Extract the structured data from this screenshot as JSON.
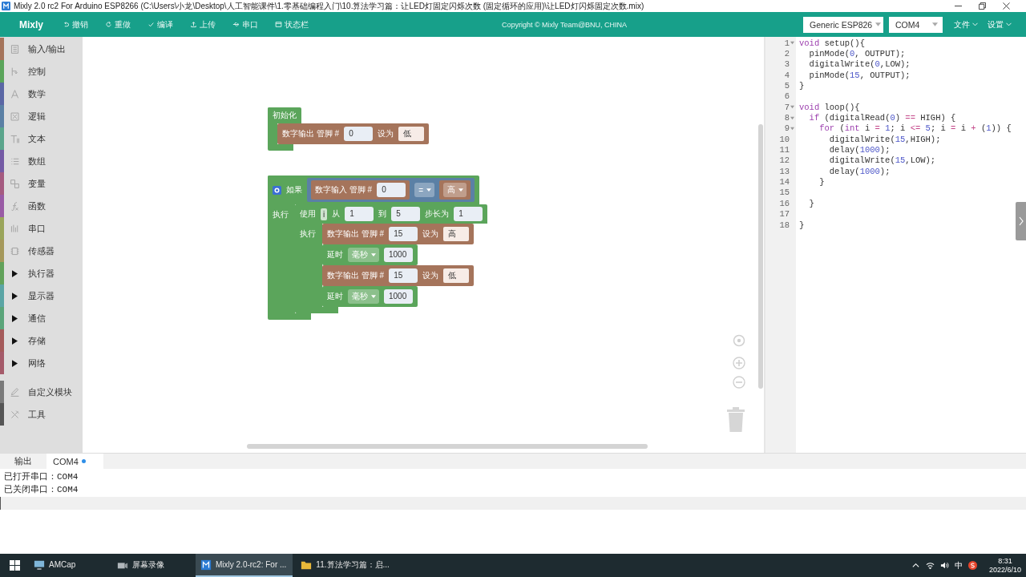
{
  "window": {
    "title": "Mixly 2.0 rc2 For Arduino ESP8266 (C:\\Users\\小龙\\Desktop\\人工智能课件\\1.零基础编程入门\\10.算法学习篇：让LED灯固定闪烁次数 (固定循环的应用)\\让LED灯闪烁固定次数.mix)"
  },
  "toolbar": {
    "brand": "Mixly",
    "buttons": [
      {
        "label": "撤销"
      },
      {
        "label": "重做"
      },
      {
        "label": "编译"
      },
      {
        "label": "上传"
      },
      {
        "label": "串口"
      },
      {
        "label": "状态栏"
      }
    ],
    "copyright": "Copyright © Mixly Team@BNU, CHINA",
    "board": "Generic ESP826",
    "port": "COM4",
    "menus": [
      {
        "label": "文件"
      },
      {
        "label": "设置"
      }
    ]
  },
  "sidebar": {
    "groups": [
      {
        "items": [
          {
            "label": "输入/输出",
            "kind": "category",
            "color": "#a5745b",
            "selected": false
          },
          {
            "label": "控制",
            "kind": "category",
            "color": "#5ba55b",
            "selected": false
          },
          {
            "label": "数学",
            "kind": "category",
            "color": "#5b67a5",
            "selected": false
          },
          {
            "label": "逻辑",
            "kind": "category",
            "color": "#5b80a5",
            "selected": false
          },
          {
            "label": "文本",
            "kind": "category",
            "color": "#5ba58c",
            "selected": false
          },
          {
            "label": "数组",
            "kind": "category",
            "color": "#745ba5",
            "selected": false
          },
          {
            "label": "变量",
            "kind": "category",
            "color": "#a55b80",
            "selected": false
          },
          {
            "label": "函数",
            "kind": "category",
            "color": "#995ba5",
            "selected": false
          },
          {
            "label": "串口",
            "kind": "category",
            "color": "#9aa55b",
            "selected": false
          },
          {
            "label": "传感器",
            "kind": "category",
            "color": "#a5985b",
            "selected": false
          },
          {
            "label": "执行器",
            "kind": "folder",
            "color": "#62a25b",
            "selected": false
          },
          {
            "label": "显示器",
            "kind": "folder",
            "color": "#5ba5a5",
            "selected": false
          },
          {
            "label": "通信",
            "kind": "folder",
            "color": "#5ba57a",
            "selected": false
          },
          {
            "label": "存储",
            "kind": "folder",
            "color": "#a55b5b",
            "selected": false
          },
          {
            "label": "网络",
            "kind": "folder",
            "color": "#a55b6a",
            "selected": false
          }
        ]
      },
      {
        "items": [
          {
            "label": "自定义模块",
            "kind": "category",
            "color": "#7a7a7a",
            "selected": false
          },
          {
            "label": "工具",
            "kind": "category",
            "color": "#555555",
            "selected": false
          }
        ]
      }
    ]
  },
  "workspace": {
    "blocks": [
      {
        "kind": "container",
        "color": "#5ba55b",
        "parts": [
          {
            "kind": "label",
            "text": "初始化"
          }
        ],
        "sections": [
          {
            "body": [
              {
                "kind": "statement",
                "color": "#a5745b",
                "parts": [
                  {
                    "kind": "label",
                    "text": "数字输出 管脚 #"
                  },
                  {
                    "kind": "number",
                    "text": "0"
                  },
                  {
                    "kind": "label",
                    "text": "设为"
                  },
                  {
                    "kind": "field",
                    "text": "低"
                  }
                ]
              }
            ]
          }
        ]
      },
      {
        "kind": "container",
        "color": "#5ba55b",
        "parts": [
          {
            "kind": "gear"
          },
          {
            "kind": "label",
            "text": "如果"
          },
          {
            "kind": "block",
            "block": {
              "kind": "value",
              "color": "#5b80a5",
              "parts": [
                {
                  "kind": "block",
                  "block": {
                    "kind": "value",
                    "color": "#a5745b",
                    "parts": [
                      {
                        "kind": "label",
                        "text": "数字输入 管脚 #"
                      },
                      {
                        "kind": "number",
                        "text": "0"
                      }
                    ]
                  }
                },
                {
                  "kind": "dropdown",
                  "text": "="
                },
                {
                  "kind": "block",
                  "block": {
                    "kind": "value",
                    "color": "#a5745b",
                    "parts": [
                      {
                        "kind": "dropdown",
                        "text": "高"
                      }
                    ]
                  }
                }
              ]
            }
          }
        ],
        "sections": [
          {
            "label": "执行",
            "body": [
              {
                "kind": "container",
                "color": "#5ba55b",
                "parts": [
                  {
                    "kind": "label",
                    "text": "使用"
                  },
                  {
                    "kind": "variable",
                    "text": "i"
                  },
                  {
                    "kind": "label",
                    "text": "从"
                  },
                  {
                    "kind": "number",
                    "text": "1"
                  },
                  {
                    "kind": "label",
                    "text": "到"
                  },
                  {
                    "kind": "number",
                    "text": "5"
                  },
                  {
                    "kind": "label",
                    "text": "步长为"
                  },
                  {
                    "kind": "number",
                    "text": "1"
                  }
                ],
                "sections": [
                  {
                    "label": "执行",
                    "body": [
                      {
                        "kind": "statement",
                        "color": "#a5745b",
                        "parts": [
                          {
                            "kind": "label",
                            "text": "数字输出 管脚 #"
                          },
                          {
                            "kind": "number",
                            "text": "15"
                          },
                          {
                            "kind": "label",
                            "text": "设为"
                          },
                          {
                            "kind": "field",
                            "text": "高"
                          }
                        ]
                      },
                      {
                        "kind": "statement",
                        "color": "#5ba55b",
                        "parts": [
                          {
                            "kind": "label",
                            "text": "延时"
                          },
                          {
                            "kind": "dropdown",
                            "text": "毫秒"
                          },
                          {
                            "kind": "number",
                            "text": "1000"
                          }
                        ]
                      },
                      {
                        "kind": "statement",
                        "color": "#a5745b",
                        "parts": [
                          {
                            "kind": "label",
                            "text": "数字输出 管脚 #"
                          },
                          {
                            "kind": "number",
                            "text": "15"
                          },
                          {
                            "kind": "label",
                            "text": "设为"
                          },
                          {
                            "kind": "field",
                            "text": "低"
                          }
                        ]
                      },
                      {
                        "kind": "statement",
                        "color": "#5ba55b",
                        "parts": [
                          {
                            "kind": "label",
                            "text": "延时"
                          },
                          {
                            "kind": "dropdown",
                            "text": "毫秒"
                          },
                          {
                            "kind": "number",
                            "text": "1000"
                          }
                        ]
                      }
                    ]
                  }
                ]
              }
            ]
          }
        ]
      }
    ]
  },
  "code": {
    "lines": [
      {
        "number": "1",
        "foldable": true,
        "tokens": [
          {
            "kind": "keyword",
            "text": "void"
          },
          {
            "kind": "plain",
            "text": " setup(){"
          }
        ]
      },
      {
        "number": "2",
        "foldable": false,
        "tokens": [
          {
            "kind": "plain",
            "text": "  pinMode("
          },
          {
            "kind": "number",
            "text": "0"
          },
          {
            "kind": "plain",
            "text": ", OUTPUT);"
          }
        ]
      },
      {
        "number": "3",
        "foldable": false,
        "tokens": [
          {
            "kind": "plain",
            "text": "  digitalWrite("
          },
          {
            "kind": "number",
            "text": "0"
          },
          {
            "kind": "plain",
            "text": ",LOW);"
          }
        ]
      },
      {
        "number": "4",
        "foldable": false,
        "tokens": [
          {
            "kind": "plain",
            "text": "  pinMode("
          },
          {
            "kind": "number",
            "text": "15"
          },
          {
            "kind": "plain",
            "text": ", OUTPUT);"
          }
        ]
      },
      {
        "number": "5",
        "foldable": false,
        "tokens": [
          {
            "kind": "plain",
            "text": "}"
          }
        ]
      },
      {
        "number": "6",
        "foldable": false
      },
      {
        "number": "7",
        "foldable": true,
        "tokens": [
          {
            "kind": "keyword",
            "text": "void"
          },
          {
            "kind": "plain",
            "text": " loop(){"
          }
        ]
      },
      {
        "number": "8",
        "foldable": true,
        "tokens": [
          {
            "kind": "keyword",
            "text": "  if"
          },
          {
            "kind": "plain",
            "text": " (digitalRead("
          },
          {
            "kind": "number",
            "text": "0"
          },
          {
            "kind": "plain",
            "text": ") "
          },
          {
            "kind": "operator",
            "text": "=="
          },
          {
            "kind": "plain",
            "text": " HIGH) {"
          }
        ]
      },
      {
        "number": "9",
        "foldable": true,
        "tokens": [
          {
            "kind": "keyword",
            "text": "    for"
          },
          {
            "kind": "plain",
            "text": " ("
          },
          {
            "kind": "keyword",
            "text": "int"
          },
          {
            "kind": "plain",
            "text": " i "
          },
          {
            "kind": "operator",
            "text": "="
          },
          {
            "kind": "number",
            "text": " 1"
          },
          {
            "kind": "plain",
            "text": "; i "
          },
          {
            "kind": "operator",
            "text": "<="
          },
          {
            "kind": "number",
            "text": " 5"
          },
          {
            "kind": "plain",
            "text": "; i "
          },
          {
            "kind": "operator",
            "text": "="
          },
          {
            "kind": "plain",
            "text": " i "
          },
          {
            "kind": "operator",
            "text": "+"
          },
          {
            "kind": "plain",
            "text": " ("
          },
          {
            "kind": "number",
            "text": "1"
          },
          {
            "kind": "plain",
            "text": ")) {"
          }
        ]
      },
      {
        "number": "10",
        "foldable": false,
        "tokens": [
          {
            "kind": "plain",
            "text": "      digitalWrite("
          },
          {
            "kind": "number",
            "text": "15"
          },
          {
            "kind": "plain",
            "text": ",HIGH);"
          }
        ]
      },
      {
        "number": "11",
        "foldable": false,
        "tokens": [
          {
            "kind": "plain",
            "text": "      delay("
          },
          {
            "kind": "number",
            "text": "1000"
          },
          {
            "kind": "plain",
            "text": ");"
          }
        ]
      },
      {
        "number": "12",
        "foldable": false,
        "tokens": [
          {
            "kind": "plain",
            "text": "      digitalWrite("
          },
          {
            "kind": "number",
            "text": "15"
          },
          {
            "kind": "plain",
            "text": ",LOW);"
          }
        ]
      },
      {
        "number": "13",
        "foldable": false,
        "tokens": [
          {
            "kind": "plain",
            "text": "      delay("
          },
          {
            "kind": "number",
            "text": "1000"
          },
          {
            "kind": "plain",
            "text": ");"
          }
        ]
      },
      {
        "number": "14",
        "foldable": false,
        "tokens": [
          {
            "kind": "plain",
            "text": "    }"
          }
        ]
      },
      {
        "number": "15",
        "foldable": false
      },
      {
        "number": "16",
        "foldable": false,
        "tokens": [
          {
            "kind": "plain",
            "text": "  }"
          }
        ]
      },
      {
        "number": "17",
        "foldable": false
      },
      {
        "number": "18",
        "foldable": false,
        "tokens": [
          {
            "kind": "plain",
            "text": "}"
          }
        ]
      }
    ]
  },
  "output_panel": {
    "tabs": [
      {
        "label": "输出",
        "selected": false,
        "status_dot": false
      },
      {
        "label": "COM4",
        "selected": true,
        "status_dot": true
      }
    ],
    "lines": [
      "已打开串口：COM4",
      "已关闭串口：COM4"
    ]
  },
  "taskbar": {
    "items": [
      {
        "label": "AMCap",
        "selected": false
      },
      {
        "label": "屏幕录像",
        "selected": false
      },
      {
        "label": "Mixly 2.0-rc2: For ...",
        "selected": true
      },
      {
        "label": "11.算法学习篇：启...",
        "selected": false
      }
    ],
    "ime": "中",
    "time": "8:31",
    "date": "2022/6/10"
  }
}
